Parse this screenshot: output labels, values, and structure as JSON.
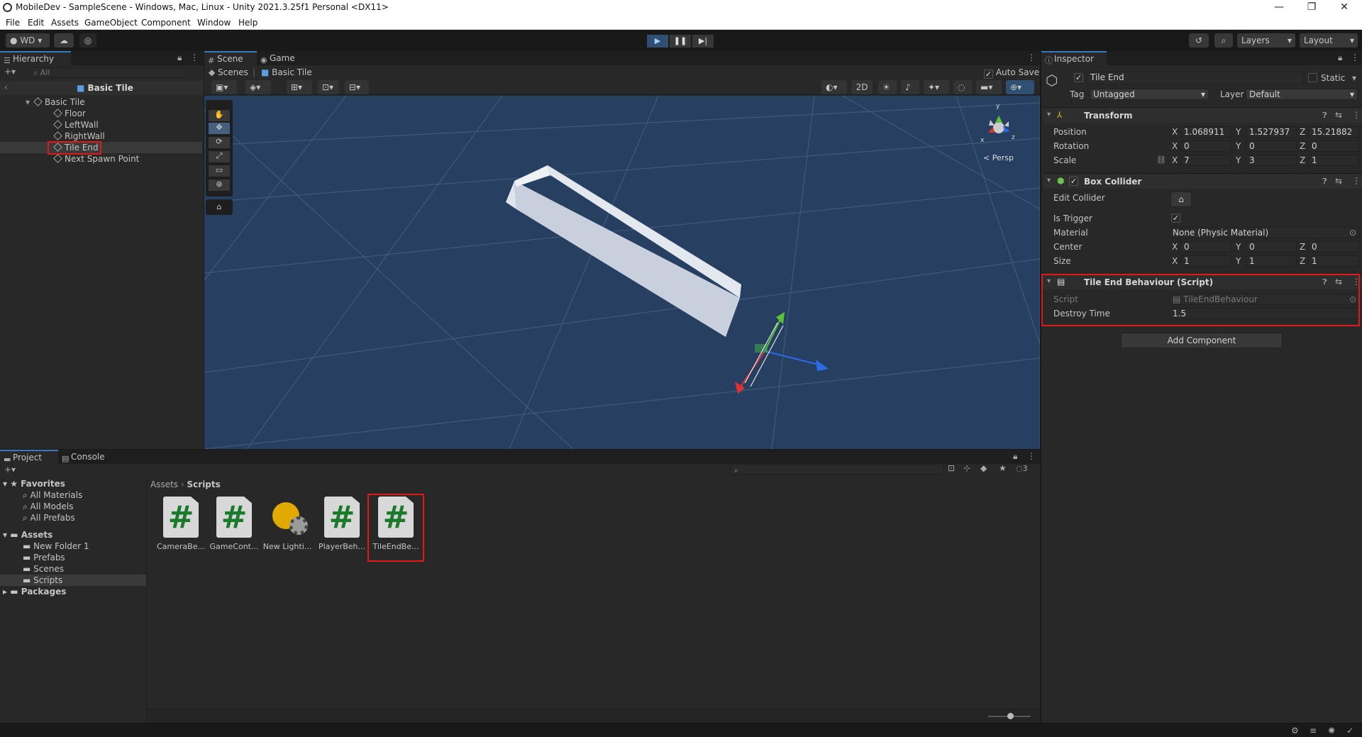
{
  "window": {
    "title": "MobileDev - SampleScene - Windows, Mac, Linux - Unity 2021.3.25f1 Personal <DX11>",
    "controls": {
      "minimize": "—",
      "maximize": "❐",
      "close": "✕"
    }
  },
  "menu": [
    "File",
    "Edit",
    "Assets",
    "GameObject",
    "Component",
    "Window",
    "Help"
  ],
  "toolbar": {
    "account": "WD",
    "layers": "Layers",
    "layout": "Layout"
  },
  "hierarchy": {
    "tab": "Hierarchy",
    "search_placeholder": "All",
    "scene_root": "Basic Tile",
    "items": [
      {
        "label": "Basic Tile",
        "depth": 1
      },
      {
        "label": "Floor",
        "depth": 2
      },
      {
        "label": "LeftWall",
        "depth": 2
      },
      {
        "label": "RightWall",
        "depth": 2
      },
      {
        "label": "Tile End",
        "depth": 2,
        "selected": true
      },
      {
        "label": "Next Spawn Point",
        "depth": 2
      }
    ]
  },
  "scene": {
    "tabs": [
      "Scene",
      "Game"
    ],
    "breadcrumb": [
      "Scenes",
      "Basic Tile"
    ],
    "auto_save": "Auto Save",
    "mode_2d": "2D",
    "persp_label": "Persp",
    "gizmo_axes": {
      "x": "x",
      "y": "y",
      "z": "z"
    }
  },
  "inspector": {
    "tab": "Inspector",
    "object_name": "Tile End",
    "static_label": "Static",
    "tag_label": "Tag",
    "tag_value": "Untagged",
    "layer_label": "Layer",
    "layer_value": "Default",
    "transform": {
      "title": "Transform",
      "position_label": "Position",
      "position": {
        "x": "1.068911",
        "y": "1.527937",
        "z": "15.21882"
      },
      "rotation_label": "Rotation",
      "rotation": {
        "x": "0",
        "y": "0",
        "z": "0"
      },
      "scale_label": "Scale",
      "scale": {
        "x": "7",
        "y": "3",
        "z": "1"
      }
    },
    "box_collider": {
      "title": "Box Collider",
      "edit_collider": "Edit Collider",
      "is_trigger": "Is Trigger",
      "material_label": "Material",
      "material_value": "None (Physic Material)",
      "center_label": "Center",
      "center": {
        "x": "0",
        "y": "0",
        "z": "0"
      },
      "size_label": "Size",
      "size": {
        "x": "1",
        "y": "1",
        "z": "1"
      }
    },
    "script_component": {
      "title": "Tile End Behaviour (Script)",
      "script_label": "Script",
      "script_value": "TileEndBehaviour",
      "destroy_time_label": "Destroy Time",
      "destroy_time_value": "1.5"
    },
    "add_component": "Add Component",
    "axis_x": "X",
    "axis_y": "Y",
    "axis_z": "Z"
  },
  "project": {
    "tabs": [
      "Project",
      "Console"
    ],
    "favorites_label": "Favorites",
    "favorites": [
      "All Materials",
      "All Models",
      "All Prefabs"
    ],
    "assets_label": "Assets",
    "folders": [
      "New Folder 1",
      "Prefabs",
      "Scenes",
      "Scripts"
    ],
    "packages_label": "Packages",
    "breadcrumb": [
      "Assets",
      "Scripts"
    ],
    "hidden_count": "3",
    "files": [
      "CameraBe...",
      "GameCont...",
      "New Lighti...",
      "PlayerBeh...",
      "TileEndBe..."
    ]
  },
  "colors": {
    "accent": "#3a79bb",
    "highlight": "#e01818",
    "scene_bg": "#274061"
  }
}
